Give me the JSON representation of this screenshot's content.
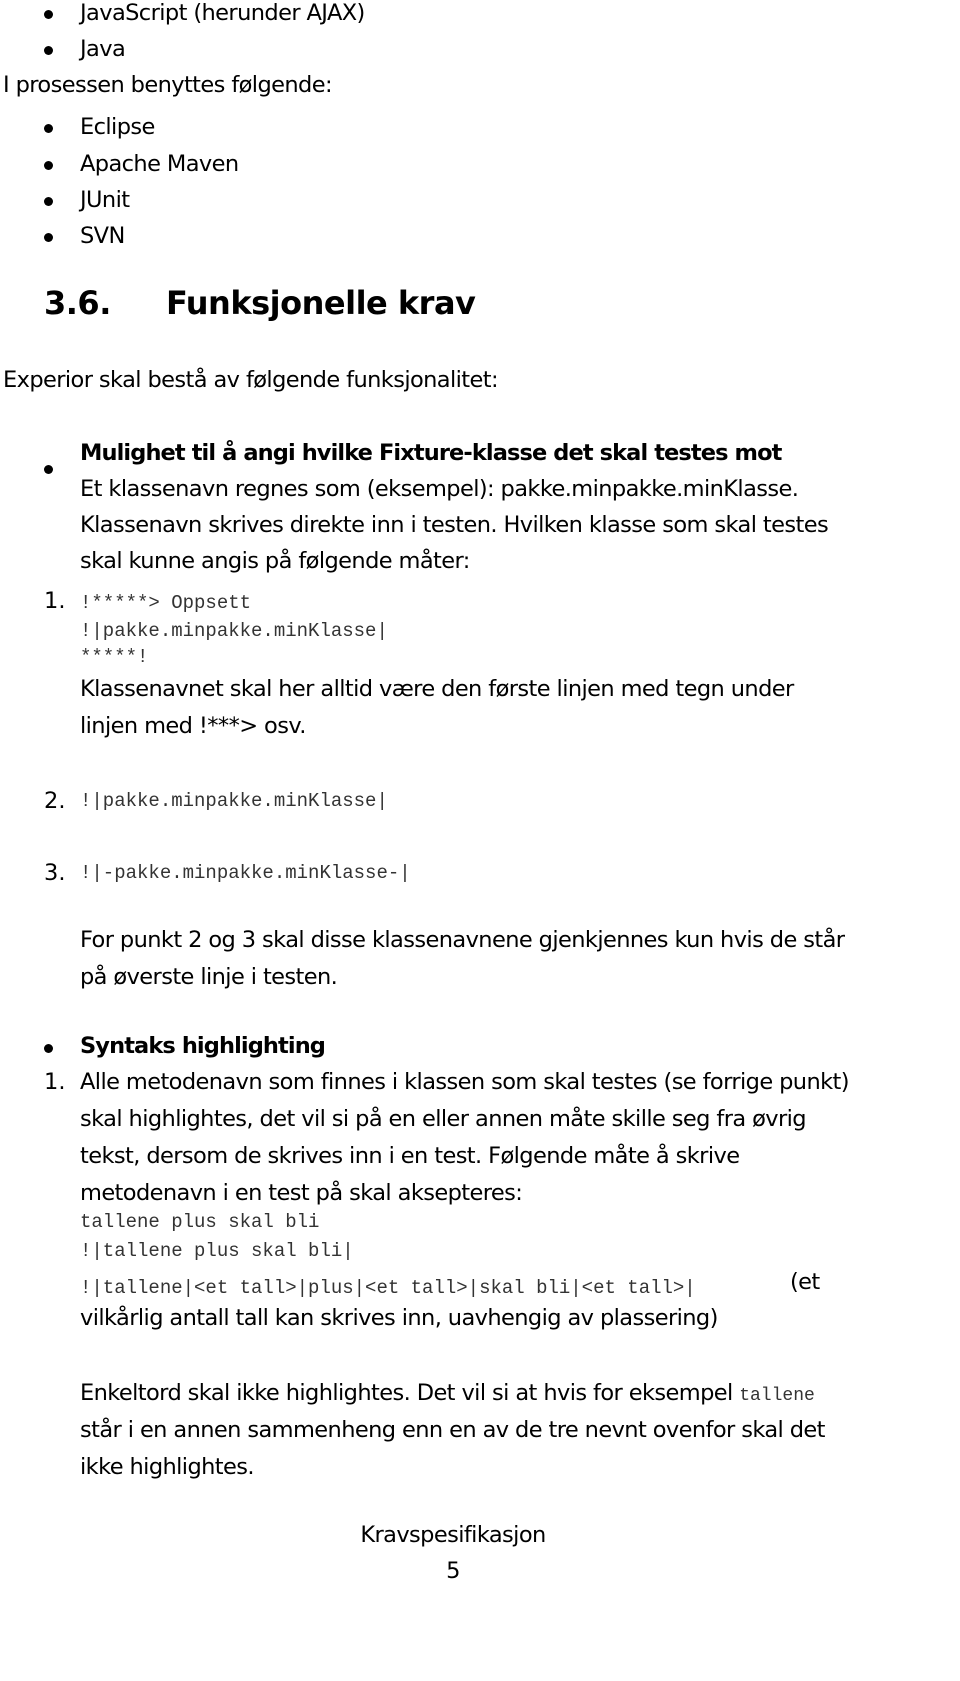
{
  "languages_tail": [
    "JavaScript (herunder AJAX)",
    "Java"
  ],
  "process_intro": "I prosessen benyttes følgende:",
  "tools": [
    "Eclipse",
    "Apache Maven",
    "JUnit",
    "SVN"
  ],
  "section": {
    "number": "3.6.",
    "title": "Funksjonelle krav"
  },
  "intro": "Experior skal bestå av følgende funksjonalitet:",
  "feature1": {
    "title": "Mulighet til å angi hvilke Fixture-klasse det skal testes mot",
    "lines": [
      "Et klassenavn regnes som (eksempel): pakke.minpakke.minKlasse.",
      "Klassenavn skrives direkte inn i testen. Hvilken klasse som skal testes",
      "skal kunne angis på følgende måter:"
    ],
    "items": [
      {
        "num": "1.",
        "code": [
          "!*****> Oppsett",
          "!|pakke.minpakke.minKlasse|",
          "*****!"
        ],
        "note": [
          "Klassenavnet skal her alltid være den første linjen med tegn under",
          "linjen med !***> osv."
        ]
      },
      {
        "num": "2.",
        "code": [
          "!|pakke.minpakke.minKlasse|"
        ]
      },
      {
        "num": "3.",
        "code": [
          "!|-pakke.minpakke.minKlasse-|"
        ]
      }
    ],
    "footer_note": [
      "For punkt 2 og 3 skal disse klassenavnene gjenkjennes kun hvis de står",
      "på øverste linje i testen."
    ]
  },
  "feature2": {
    "title": "Syntaks highlighting",
    "num": "1.",
    "lines": [
      "Alle metodenavn som finnes i klassen som skal testes (se forrige punkt)",
      "skal highlightes, det vil si på en eller annen måte skille seg fra øvrig",
      "tekst, dersom de skrives inn i en test. Følgende måte å skrive",
      "metodenavn i en test på skal aksepteres:"
    ],
    "code": [
      "tallene plus skal bli",
      "!|tallene plus skal bli|",
      "!|tallene|<et tall>|plus|<et tall>|skal bli|<et tall>|"
    ],
    "code_suffix": "(et",
    "cont": "vilkårlig antall tall kan skrives inn, uavhengig av plassering)",
    "para": {
      "line1": "Enkeltord skal ikke highlightes. Det vil si at hvis for eksempel",
      "line1_code": "tallene",
      "line2": "står i en annen sammenheng enn en av de tre nevnt ovenfor skal det",
      "line3": "ikke highlightes."
    }
  },
  "footer": {
    "label": "Kravspesifikasjon",
    "page": "5"
  }
}
